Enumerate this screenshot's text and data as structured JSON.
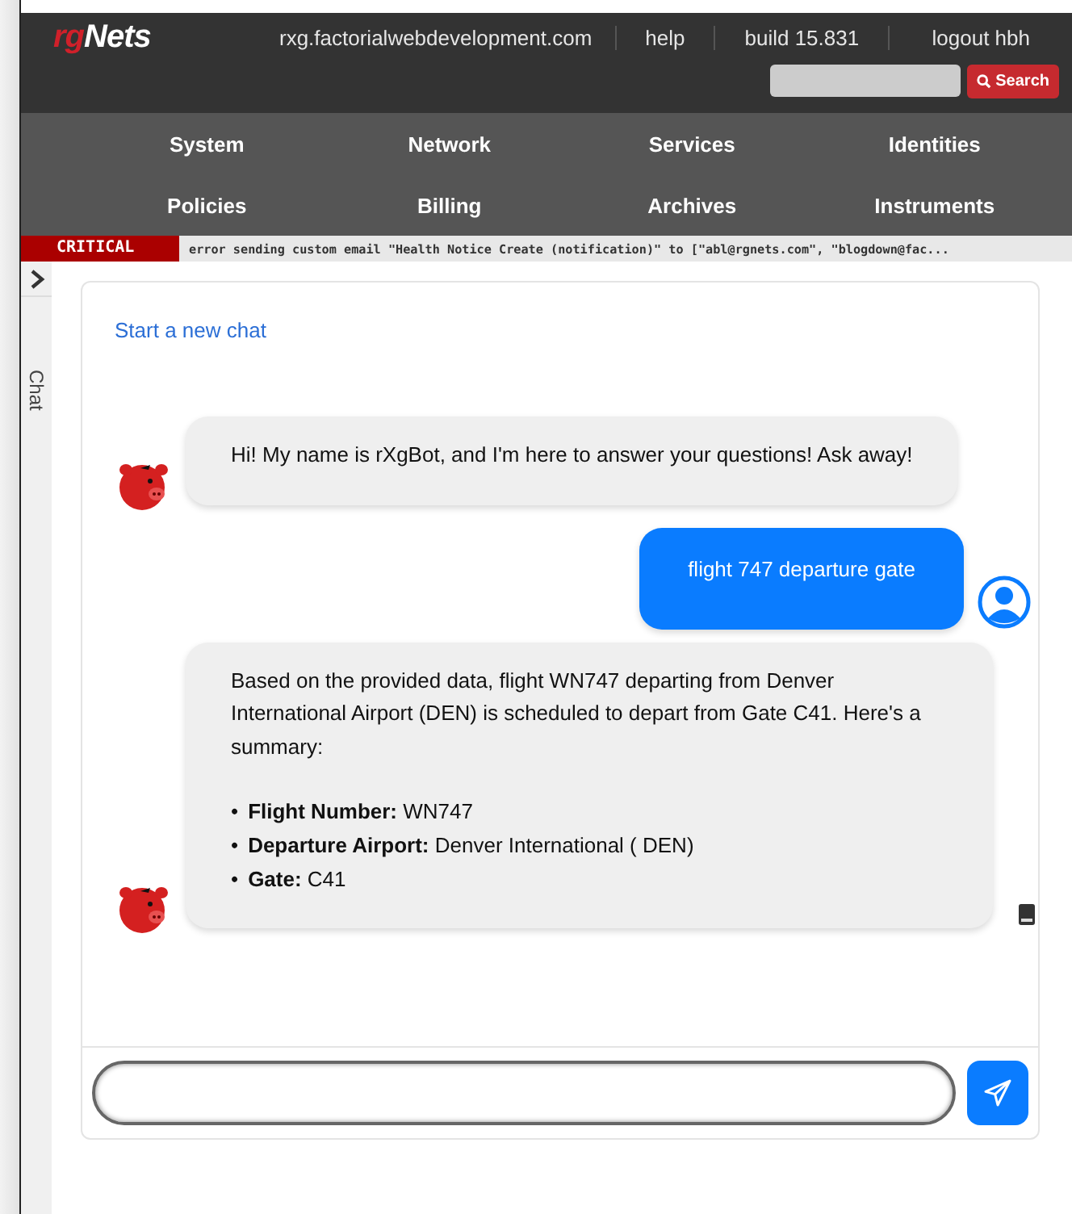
{
  "header": {
    "logo": "rgNets",
    "host": "rxg.factorialwebdevelopment.com",
    "links": [
      "help",
      "build 15.831",
      "logout hbh"
    ],
    "search": {
      "button": "Search"
    }
  },
  "nav": [
    "System",
    "Network",
    "Services",
    "Identities",
    "Policies",
    "Billing",
    "Archives",
    "Instruments"
  ],
  "alert": {
    "level": "CRITICAL",
    "message": "error sending custom email \"Health Notice Create (notification)\" to [\"abl@rgnets.com\", \"blogdown@fac..."
  },
  "side_tab": {
    "label": "Chat"
  },
  "chat": {
    "new_chat": "Start a new chat",
    "messages": [
      {
        "kind": "bot",
        "text": "Hi! My name is rXgBot, and I'm here to answer your questions! Ask away!"
      },
      {
        "kind": "user",
        "text": "flight 747 departure gate"
      },
      {
        "kind": "bot",
        "text": "Based on the provided data, flight WN747 departing from Denver International Airport (DEN) is scheduled to depart from Gate C41. Here's a summary:",
        "list": [
          {
            "bullet": "•",
            "text": "**Flight Number:** WN747"
          },
          {
            "bullet": "•",
            "text": "**Departure Airport:** Denver International ( DEN)"
          },
          {
            "bullet": "•",
            "text": "**Gate:** C41"
          }
        ],
        "source": true
      }
    ]
  }
}
